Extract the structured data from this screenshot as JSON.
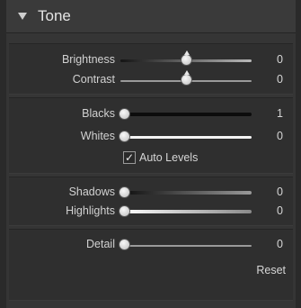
{
  "panel": {
    "title": "Tone",
    "collapse_icon": "triangle-down-icon"
  },
  "sliders": {
    "brightness": {
      "label": "Brightness",
      "value": "0",
      "position": 0.5
    },
    "contrast": {
      "label": "Contrast",
      "value": "0",
      "position": 0.5
    },
    "blacks": {
      "label": "Blacks",
      "value": "1",
      "position": 0.0
    },
    "whites": {
      "label": "Whites",
      "value": "0",
      "position": 0.0
    },
    "shadows": {
      "label": "Shadows",
      "value": "0",
      "position": 0.0
    },
    "highlights": {
      "label": "Highlights",
      "value": "0",
      "position": 0.0
    },
    "detail": {
      "label": "Detail",
      "value": "0",
      "position": 0.0
    }
  },
  "auto_levels": {
    "label": "Auto Levels",
    "checked": true,
    "check_glyph": "✓"
  },
  "reset_label": "Reset"
}
